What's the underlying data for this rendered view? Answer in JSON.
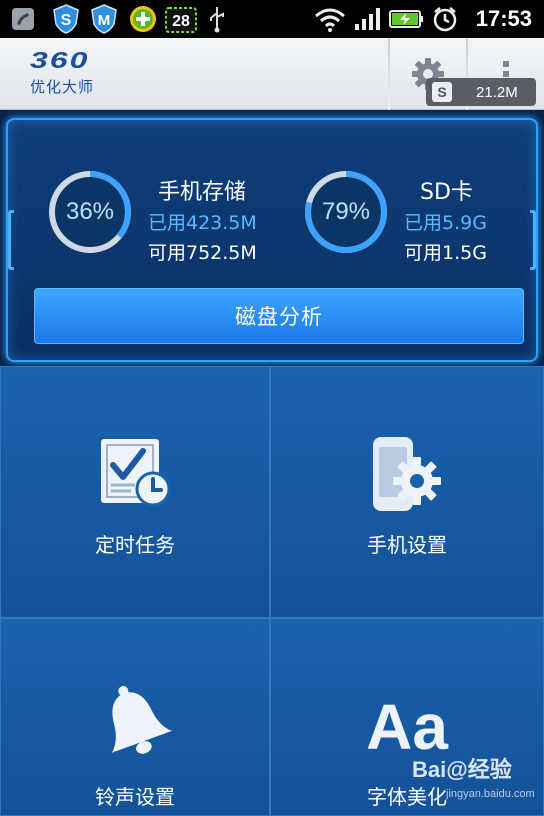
{
  "status_bar": {
    "time": "17:53",
    "battery_small_label": "28",
    "icons": [
      "missed-call-icon",
      "360-shield-s-icon",
      "360-shield-m-icon",
      "plus-icon",
      "battery-28-icon",
      "usb-icon",
      "wifi-icon",
      "signal-icon",
      "battery-charging-icon",
      "alarm-icon"
    ]
  },
  "app_header": {
    "logo_number": "360",
    "logo_subtitle": "优化大师",
    "memory_badge": "21.2M",
    "memory_badge_icon_letter": "S"
  },
  "storage": {
    "phone": {
      "percent_label": "36%",
      "percent": 0.36,
      "title": "手机存储",
      "used": "已用423.5M",
      "available": "可用752.5M"
    },
    "sd": {
      "percent_label": "79%",
      "percent": 0.79,
      "title": "SD卡",
      "used": "已用5.9G",
      "available": "可用1.5G"
    },
    "analyze_button": "磁盘分析"
  },
  "tiles": {
    "scheduled_tasks": "定时任务",
    "phone_settings": "手机设置",
    "ringtone_settings": "铃声设置",
    "font_beautify": "字体美化",
    "font_icon_text": "Aa"
  },
  "watermark": {
    "main": "Bai@经验",
    "sub": "jingyan.baidu.com"
  },
  "colors": {
    "accent": "#2aa0ff",
    "panel": "#0a2f62",
    "tile": "#1b62ad",
    "button": "#1a78e8"
  }
}
